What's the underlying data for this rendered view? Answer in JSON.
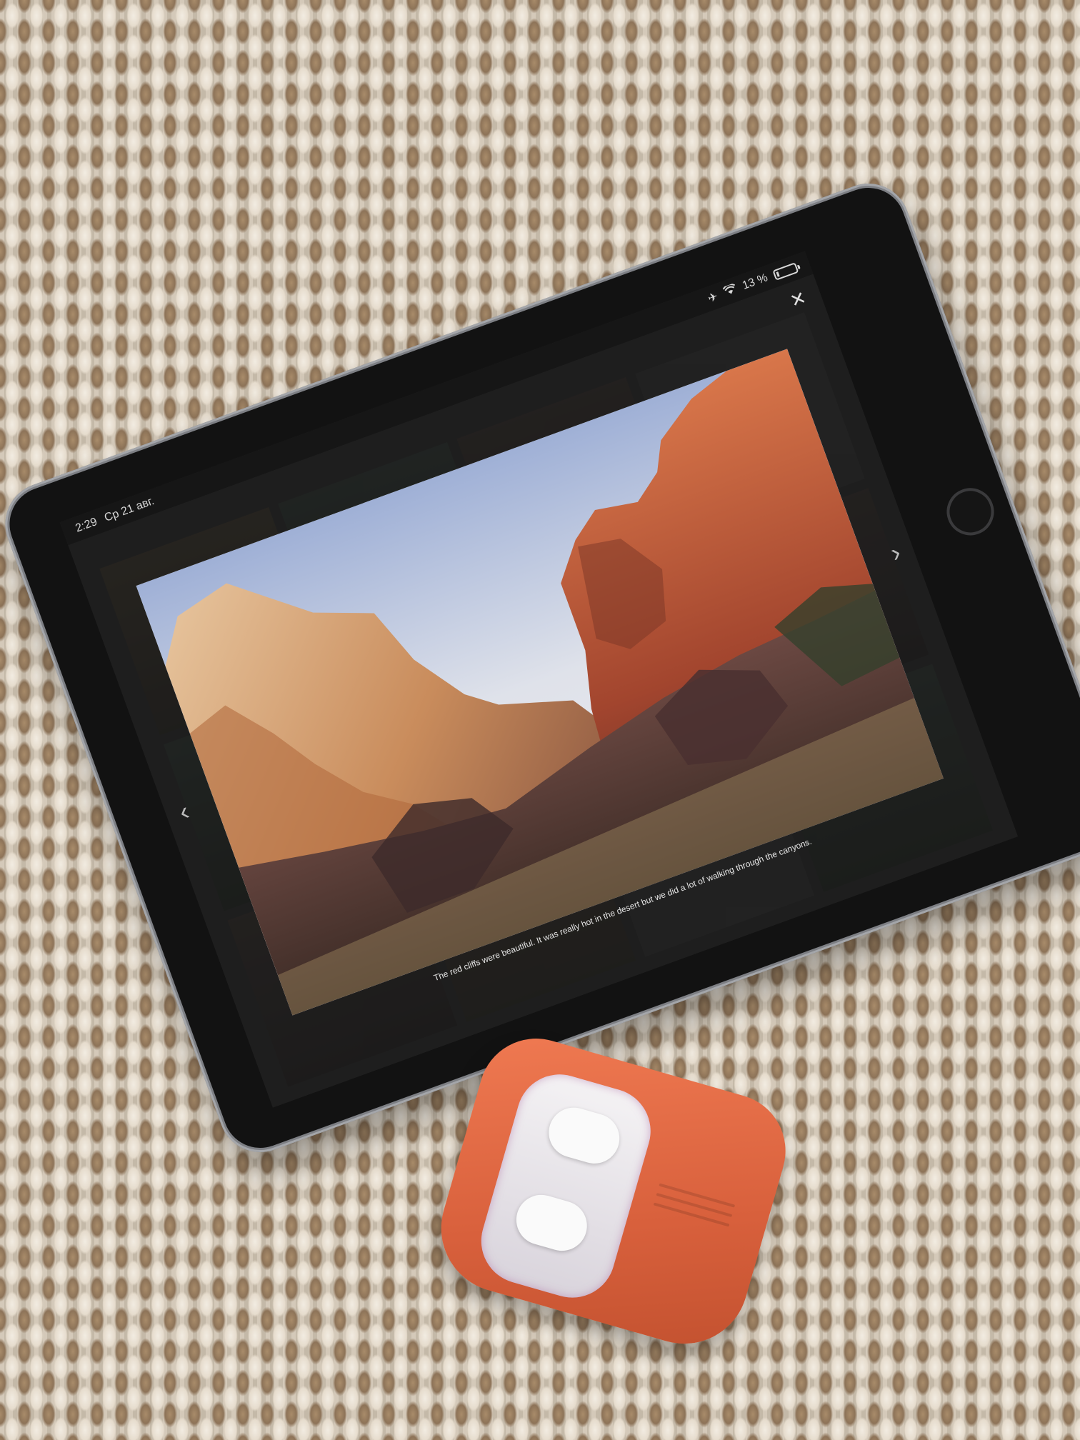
{
  "status_bar": {
    "time": "2:29",
    "date": "Ср 21 авг.",
    "battery_percent": "13 %",
    "battery_level": 0.13,
    "icons": [
      "airplane-mode-icon",
      "wifi-icon",
      "battery-icon"
    ]
  },
  "lightbox": {
    "close_glyph": "✕",
    "prev_glyph": "‹",
    "next_glyph": "›",
    "caption": "The red cliffs were beautiful.  It was really hot in the desert but we did a lot of walking through the canyons."
  },
  "colors": {
    "case": "#e06840",
    "screen_bg": "#2a2a2a",
    "rug_light": "#f2ece2",
    "rug_dark": "#8d7358"
  }
}
